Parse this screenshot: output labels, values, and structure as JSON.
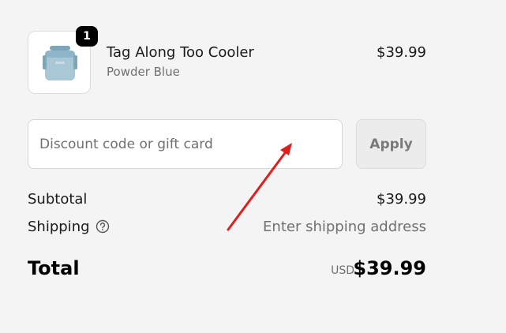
{
  "line_item": {
    "quantity": "1",
    "name": "Tag Along Too Cooler",
    "variant": "Powder Blue",
    "price": "$39.99",
    "image_icon": "cooler-product-image"
  },
  "discount": {
    "placeholder": "Discount code or gift card",
    "value": "",
    "apply_label": "Apply"
  },
  "summary": {
    "subtotal_label": "Subtotal",
    "subtotal_value": "$39.99",
    "shipping_label": "Shipping",
    "shipping_value": "Enter shipping address",
    "help_icon": "question-circle-icon"
  },
  "total": {
    "label": "Total",
    "currency": "USD",
    "amount": "$39.99"
  },
  "colors": {
    "background": "#f4f4f4",
    "annotation_arrow": "#e11d1d",
    "product_blue": "#9fc0cf"
  }
}
